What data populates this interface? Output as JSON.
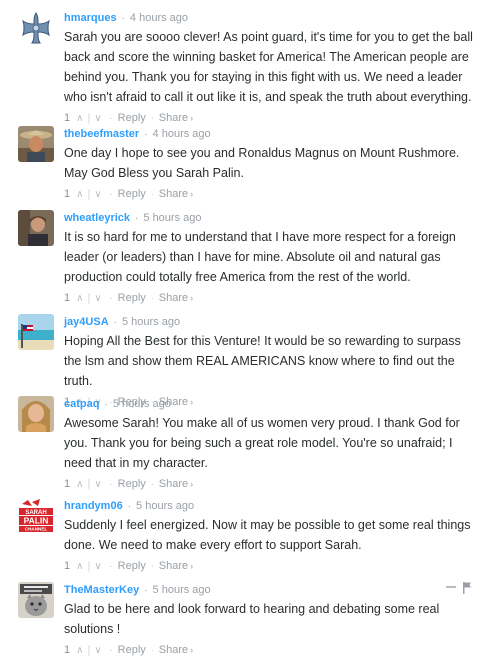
{
  "comments": [
    {
      "author": "hmarques",
      "time": "4 hours ago",
      "text": "Sarah you are soooo clever! As point guard, it's time for you to get the ball back and score the winning basket for America! The American people are behind you. Thank you for staying in this fight with us. We need a leader who isn't afraid to call it out like it is, and speak the truth about everything.",
      "votes": "1",
      "avatar": "cross-icon"
    },
    {
      "author": "thebeefmaster",
      "time": "4 hours ago",
      "text": "One day I hope to see you and Ronaldus Magnus on Mount Rushmore. May God Bless you Sarah Palin.",
      "votes": "1",
      "avatar": "cowboy-photo"
    },
    {
      "author": "wheatleyrick",
      "time": "5 hours ago",
      "text": "It is so hard for me to understand that I have more respect for a foreign leader (or leaders) than I have for mine. Absolute oil and natural gas production could totally free America from the rest of the world.",
      "votes": "1",
      "avatar": "man-photo"
    },
    {
      "author": "jay4USA",
      "time": "5 hours ago",
      "text": "Hoping All the Best for this Venture! It would be so rewarding to surpass the lsm and show them REAL AMERICANS know where to find out the truth.",
      "votes": "1",
      "avatar": "beach-flag-photo"
    },
    {
      "author": "catpaq",
      "time": "5 hours ago",
      "text": "Awesome Sarah! You make all of us women very proud. I thank God for you. Thank you for being such a great role model. You're so unafraid; I need that in my character.",
      "votes": "1",
      "avatar": "woman-photo"
    },
    {
      "author": "hrandym06",
      "time": "5 hours ago",
      "text": "Suddenly I feel energized. Now it may be possible to get some real things done. We need to make every effort to support Sarah.",
      "votes": "1",
      "avatar": "sarah-palin-channel-logo",
      "avatar_text": "SARAH PALIN CHANNEL"
    },
    {
      "author": "TheMasterKey",
      "time": "5 hours ago",
      "text": "Glad to be here and look forward to hearing and debating some real solutions !",
      "votes": "1",
      "avatar": "cat-photo"
    }
  ],
  "labels": {
    "reply": "Reply",
    "share": "Share",
    "separator": "·",
    "upvote": "∧",
    "downvote": "∨",
    "share_caret": "›"
  },
  "colors": {
    "author": "#2e9fff",
    "muted": "#9aa0a6",
    "text": "#2a2e2e",
    "logo_red": "#d8262c"
  }
}
